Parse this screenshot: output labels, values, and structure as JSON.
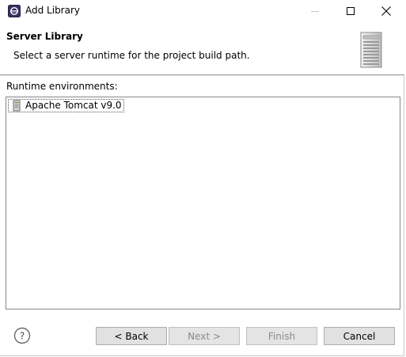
{
  "window": {
    "title": "Add Library"
  },
  "banner": {
    "title": "Server Library",
    "description": "Select a server runtime for the project build path."
  },
  "runtimes": {
    "label": "Runtime environments:",
    "items": [
      {
        "label": "Apache Tomcat v9.0",
        "icon": "tomcat-server-icon"
      }
    ]
  },
  "buttons": {
    "back": "< Back",
    "next": "Next >",
    "finish": "Finish",
    "cancel": "Cancel"
  },
  "colors": {
    "button_bg": "#e1e1e1",
    "disabled_text": "#8a8a8a",
    "list_border": "#828790"
  }
}
